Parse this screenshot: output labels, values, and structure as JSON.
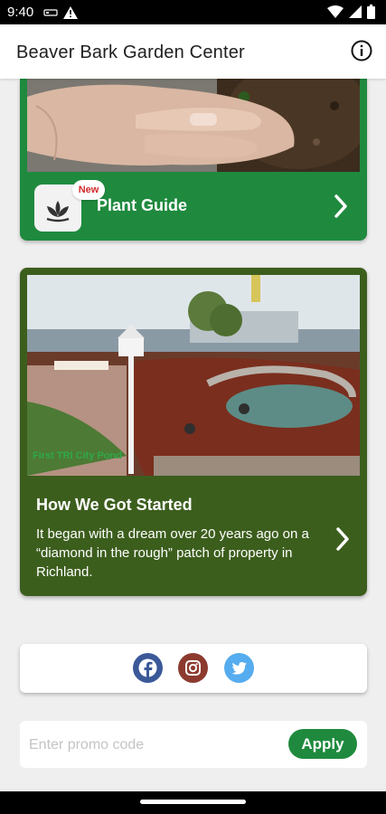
{
  "status_bar": {
    "time": "9:40",
    "left_icons": [
      "sim-icon",
      "alert-icon"
    ],
    "right_icons": [
      "wifi-icon",
      "signal-icon",
      "battery-icon"
    ]
  },
  "app_bar": {
    "title": "Beaver Bark Garden Center",
    "info_icon": "info-icon"
  },
  "plant_guide_card": {
    "badge": "New",
    "label": "Plant Guide",
    "icon": "lotus-icon",
    "chevron": "chevron-right-icon"
  },
  "story_card": {
    "photo_caption": "First TRI City Pond",
    "title": "How We Got Started",
    "body": "It began with a dream over 20 years ago on a “diamond in the rough” patch of property in Richland.",
    "chevron": "chevron-right-icon"
  },
  "social": {
    "facebook_color": "#3b5998",
    "instagram_color": "#8d3a2e",
    "twitter_color": "#55acee",
    "icons": [
      "facebook-icon",
      "instagram-icon",
      "twitter-icon"
    ]
  },
  "promo": {
    "placeholder": "Enter promo code",
    "value": "",
    "apply_label": "Apply"
  },
  "colors": {
    "brand_green": "#1f8a3e",
    "story_green": "#3c5e1d"
  }
}
